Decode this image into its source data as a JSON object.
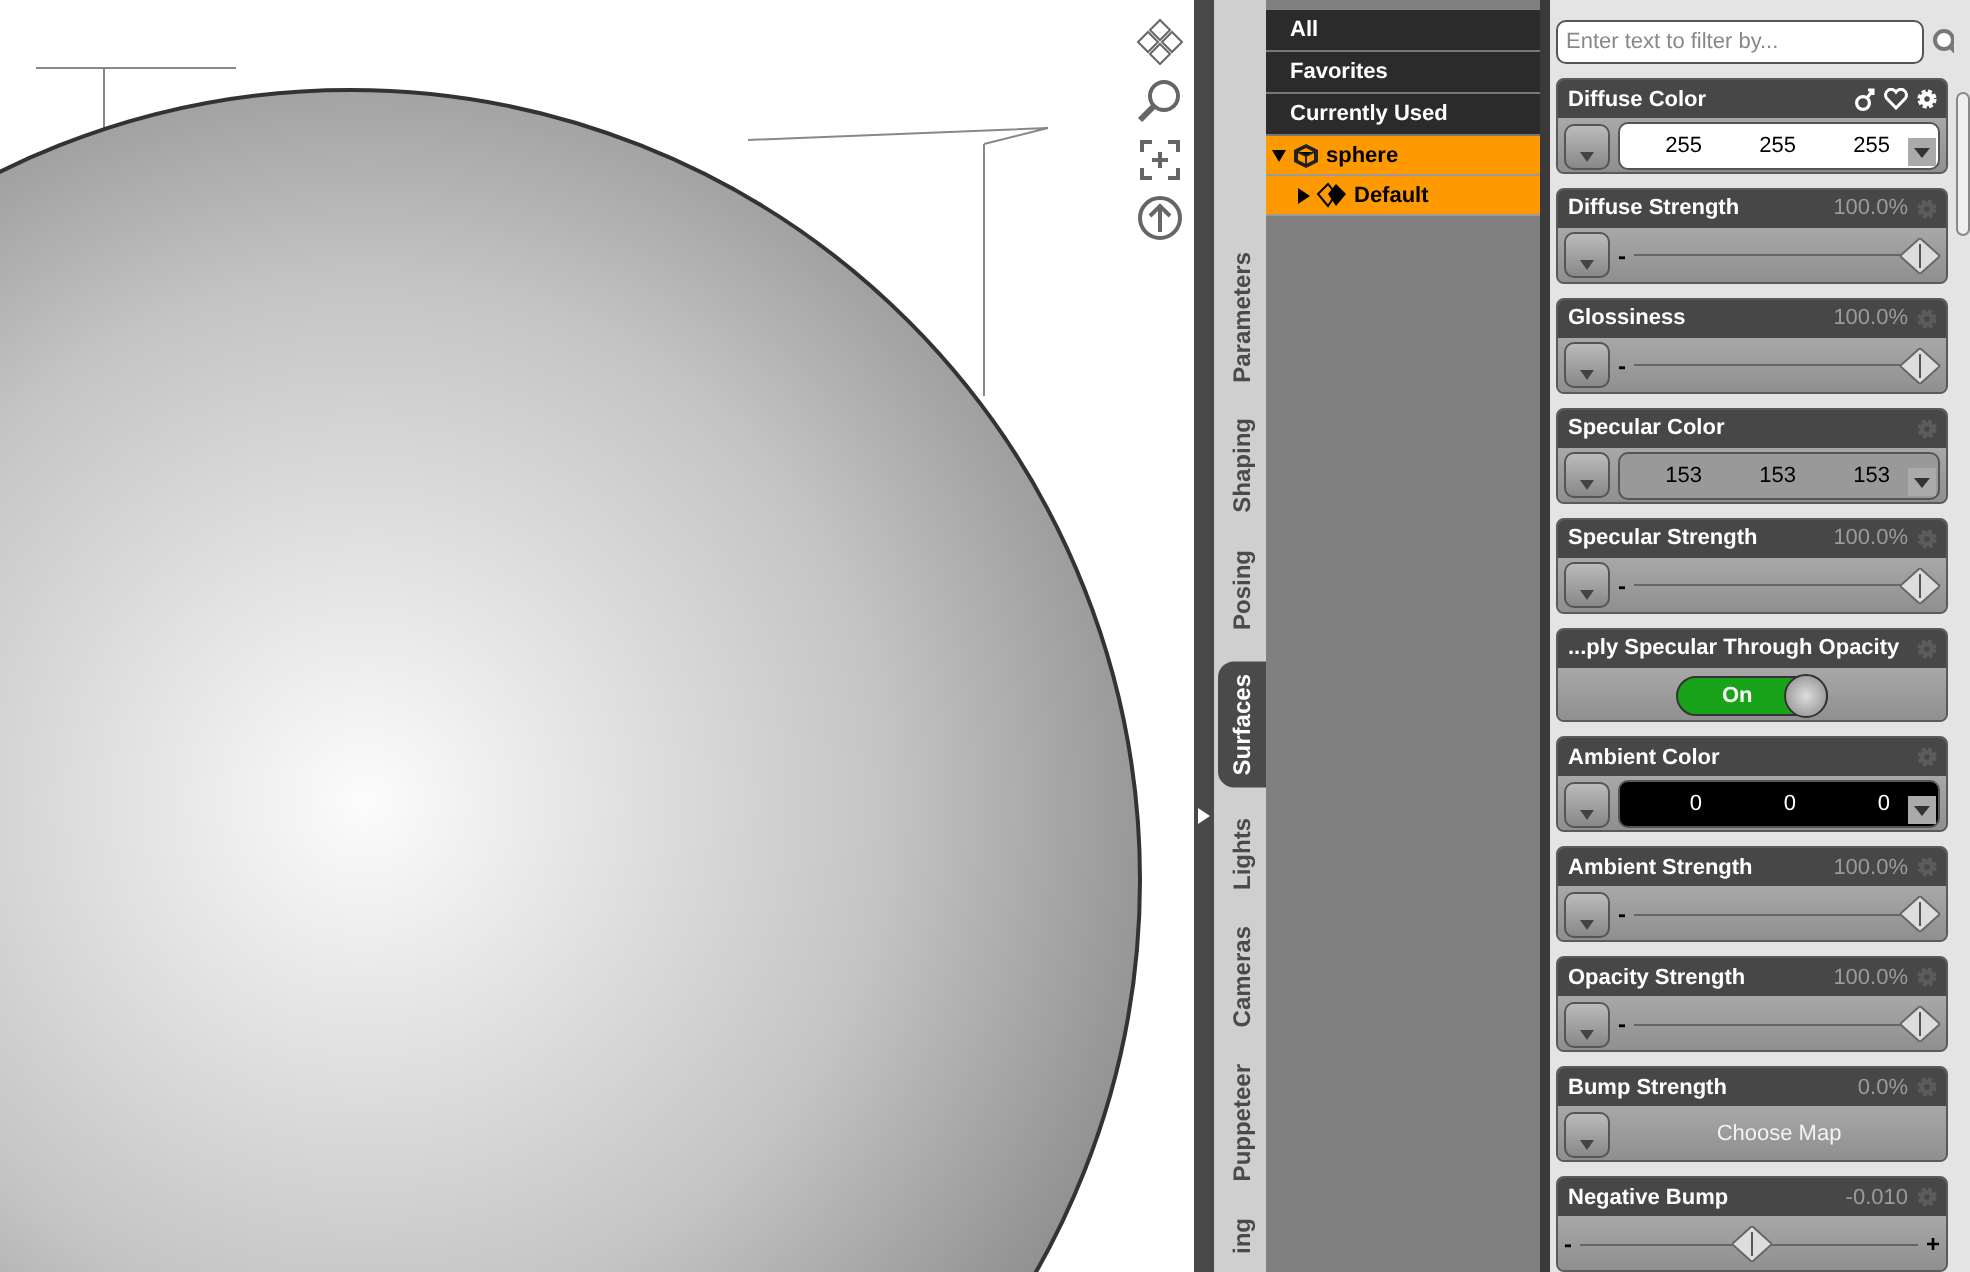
{
  "side_tabs": [
    {
      "label": "Parameters",
      "selected": false
    },
    {
      "label": "Shaping",
      "selected": false
    },
    {
      "label": "Posing",
      "selected": false
    },
    {
      "label": "Surfaces",
      "selected": true
    },
    {
      "label": "Lights",
      "selected": false
    },
    {
      "label": "Cameras",
      "selected": false
    },
    {
      "label": "Puppeteer",
      "selected": false
    },
    {
      "label": "ing",
      "selected": false
    }
  ],
  "tree": {
    "filters": [
      {
        "label": "All"
      },
      {
        "label": "Favorites"
      },
      {
        "label": "Currently Used"
      }
    ],
    "items": [
      {
        "label": "sphere",
        "kind": "figure",
        "selected": true,
        "expanded": true,
        "children": [
          {
            "label": "Default",
            "kind": "surface",
            "selected": true,
            "expanded": false
          }
        ]
      }
    ]
  },
  "filter": {
    "placeholder": "Enter text to filter by..."
  },
  "properties": [
    {
      "kind": "color",
      "name": "Diffuse Color",
      "active": true,
      "values": [
        "255",
        "255",
        "255"
      ],
      "color": "#ffffff"
    },
    {
      "kind": "slider",
      "name": "Diffuse Strength",
      "reading": "100.0%",
      "min_mark": "-",
      "level": 1
    },
    {
      "kind": "slider",
      "name": "Glossiness",
      "reading": "100.0%",
      "min_mark": "-",
      "level": 1
    },
    {
      "kind": "color",
      "name": "Specular Color",
      "active": false,
      "values": [
        "153",
        "153",
        "153"
      ],
      "color": "#999999"
    },
    {
      "kind": "slider",
      "name": "Specular Strength",
      "reading": "100.0%",
      "min_mark": "-",
      "level": 1
    },
    {
      "kind": "toggle",
      "name": "...ply Specular Through Opacity",
      "on": true,
      "label": "On"
    },
    {
      "kind": "color",
      "name": "Ambient Color",
      "active": false,
      "values": [
        "0",
        "0",
        "0"
      ],
      "color": "#000000"
    },
    {
      "kind": "slider",
      "name": "Ambient Strength",
      "reading": "100.0%",
      "min_mark": "-",
      "level": 1
    },
    {
      "kind": "slider",
      "name": "Opacity Strength",
      "reading": "100.0%",
      "min_mark": "-",
      "level": 1
    },
    {
      "kind": "map",
      "name": "Bump Strength",
      "reading": "0.0%",
      "label": "Choose Map"
    },
    {
      "kind": "centered",
      "name": "Negative Bump",
      "reading": "-0.010",
      "min_mark": "-",
      "max_mark": "+",
      "level": 0.5
    }
  ]
}
